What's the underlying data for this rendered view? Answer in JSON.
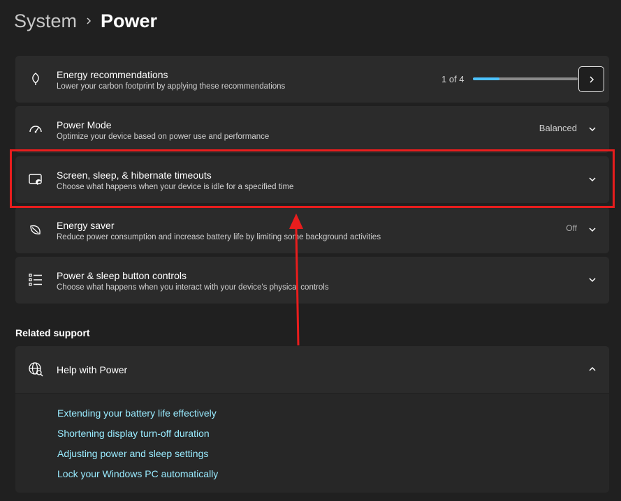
{
  "breadcrumb": {
    "parent": "System",
    "current": "Power"
  },
  "cards": {
    "energy_recommendations": {
      "title": "Energy recommendations",
      "desc": "Lower your carbon footprint by applying these recommendations",
      "count": "1 of 4",
      "progress_fraction": 0.25,
      "icon": "leaf-icon"
    },
    "power_mode": {
      "title": "Power Mode",
      "desc": "Optimize your device based on power use and performance",
      "value": "Balanced",
      "icon": "gauge-icon"
    },
    "screen_sleep": {
      "title": "Screen, sleep, & hibernate timeouts",
      "desc": "Choose what happens when your device is idle for a specified time",
      "icon": "screen-sleep-icon"
    },
    "energy_saver": {
      "title": "Energy saver",
      "desc": "Reduce power consumption and increase battery life by limiting some background activities",
      "value": "Off",
      "icon": "energy-saver-leaf-icon"
    },
    "power_buttons": {
      "title": "Power & sleep button controls",
      "desc": "Choose what happens when you interact with your device's physical controls",
      "icon": "list-icon"
    }
  },
  "related_support": {
    "label": "Related support",
    "help": {
      "title": "Help with Power",
      "icon": "globe-search-icon",
      "links": [
        "Extending your battery life effectively",
        "Shortening display turn-off duration",
        "Adjusting power and sleep settings",
        "Lock your Windows PC automatically"
      ]
    }
  },
  "colors": {
    "accent": "#4cc2ff",
    "link": "#99ebff",
    "annotation": "#e81d1d",
    "card_bg": "#2b2b2b",
    "page_bg": "#202020"
  }
}
